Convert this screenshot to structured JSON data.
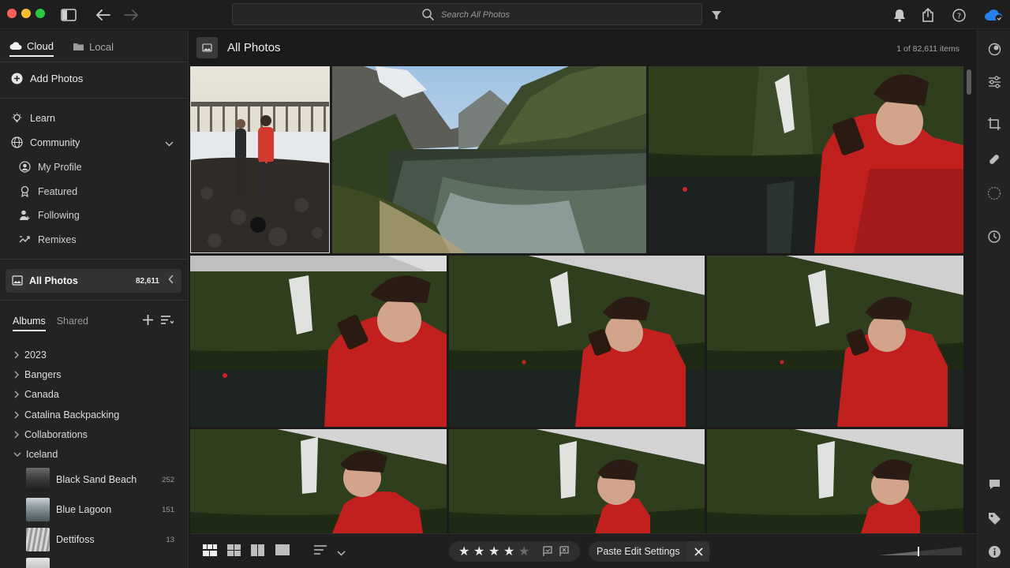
{
  "window": {
    "search_placeholder": "Search All Photos"
  },
  "sidebar": {
    "tabs": [
      {
        "label": "Cloud",
        "active": true
      },
      {
        "label": "Local",
        "active": false
      }
    ],
    "add_photos": "Add Photos",
    "learn": "Learn",
    "community": "Community",
    "community_items": [
      "My Profile",
      "Featured",
      "Following",
      "Remixes"
    ],
    "all_photos": {
      "label": "All Photos",
      "count": "82,611"
    },
    "album_tabs": {
      "albums": "Albums",
      "shared": "Shared"
    },
    "album_folders": [
      "2023",
      "Bangers",
      "Canada",
      "Catalina Backpacking",
      "Collaborations",
      "Iceland"
    ],
    "iceland_albums": [
      {
        "name": "Black Sand Beach",
        "count": "252"
      },
      {
        "name": "Blue Lagoon",
        "count": "151"
      },
      {
        "name": "Dettifoss",
        "count": "13"
      }
    ]
  },
  "main": {
    "title": "All Photos",
    "item_count": "1 of 82,611 items"
  },
  "bottombar": {
    "rating_stars": 4,
    "rating_max": 5,
    "paste_label": "Paste Edit Settings"
  },
  "colors": {
    "background": "#1a1a1a",
    "panel": "#232323",
    "selection": "#333333",
    "accent": "#2680eb"
  }
}
